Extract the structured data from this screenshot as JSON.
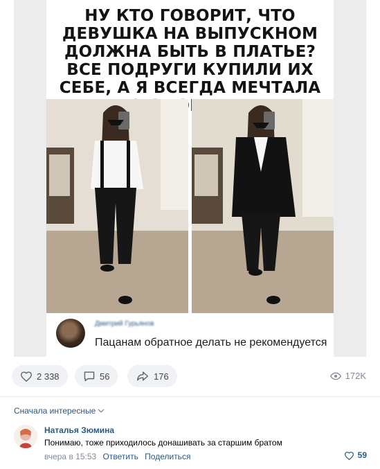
{
  "post": {
    "caption": "НУ КТО ГОВОРИТ, ЧТО ДЕВУШКА НА ВЫПУСКНОМ ДОЛЖНА БЫТЬ В ПЛАТЬЕ? ВСЕ ПОДРУГИ КУПИЛИ ИХ СЕБЕ, А Я ВСЕГДА МЕЧТАЛА О СМОКИНГЕ",
    "embedded_comment": {
      "author_name": "Дмитрий Гурьянов",
      "text": "Пацанам обратное делать не рекомендуется"
    }
  },
  "actions": {
    "likes": "2 338",
    "comments": "56",
    "shares": "176",
    "views": "172K"
  },
  "comments_section": {
    "sort_label": "Сначала интересные",
    "items": [
      {
        "author": "Наталья Зюмина",
        "text": "Понимаю, тоже приходилось донашивать за старшим братом",
        "time": "вчера в 15:53",
        "reply_label": "Ответить",
        "share_label": "Поделиться",
        "likes": "59"
      }
    ]
  },
  "colors": {
    "link": "#2a5885",
    "muted": "#818c99",
    "pill_bg": "#f0f2f5"
  }
}
